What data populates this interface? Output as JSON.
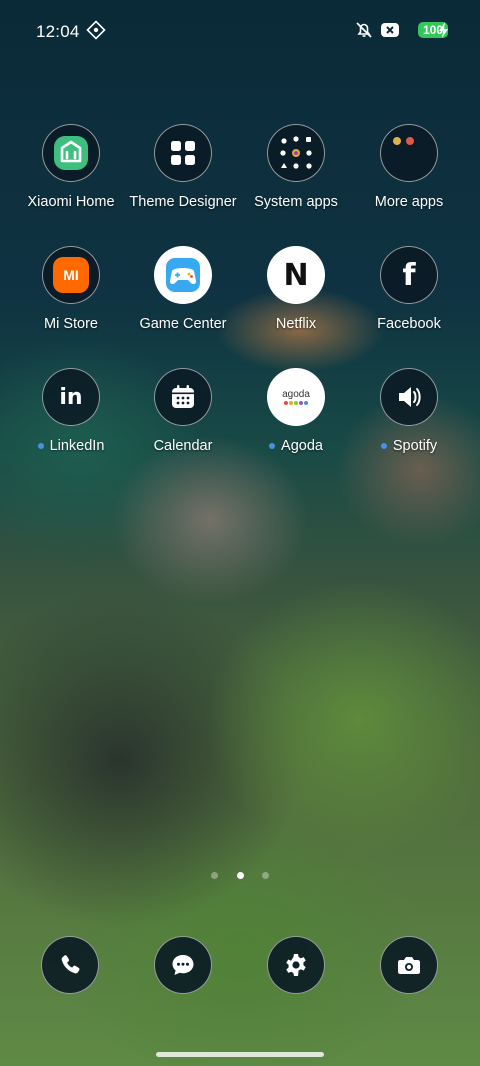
{
  "status_bar": {
    "time": "12:04",
    "battery": "100"
  },
  "apps": [
    {
      "label": "Xiaomi Home",
      "icon": "xiaomi-home-icon",
      "dot": false
    },
    {
      "label": "Theme Designer",
      "icon": "theme-designer-icon",
      "dot": false
    },
    {
      "label": "System apps",
      "icon": "system-apps-folder-icon",
      "dot": false
    },
    {
      "label": "More apps",
      "icon": "more-apps-folder-icon",
      "dot": false
    },
    {
      "label": "Mi Store",
      "icon": "mi-store-icon",
      "dot": false
    },
    {
      "label": "Game Center",
      "icon": "game-center-icon",
      "dot": false
    },
    {
      "label": "Netflix",
      "icon": "netflix-icon",
      "dot": false
    },
    {
      "label": "Facebook",
      "icon": "facebook-icon",
      "dot": false
    },
    {
      "label": "LinkedIn",
      "icon": "linkedin-icon",
      "dot": true
    },
    {
      "label": "Calendar",
      "icon": "calendar-icon",
      "dot": false
    },
    {
      "label": "Agoda",
      "icon": "agoda-icon",
      "dot": true
    },
    {
      "label": "Spotify",
      "icon": "spotify-icon",
      "dot": true
    }
  ],
  "agoda_wordmark": "agoda",
  "mi_wordmark": "MI",
  "netflix_letter": "N",
  "facebook_letter": "f",
  "linkedin_letters": "in",
  "pager": {
    "pages": 3,
    "active": 2
  },
  "dock": [
    {
      "icon": "phone-icon"
    },
    {
      "icon": "messages-icon"
    },
    {
      "icon": "settings-icon"
    },
    {
      "icon": "camera-icon"
    }
  ],
  "colors": {
    "battery": "#34c759",
    "new_app_dot": "#4a90e2"
  }
}
